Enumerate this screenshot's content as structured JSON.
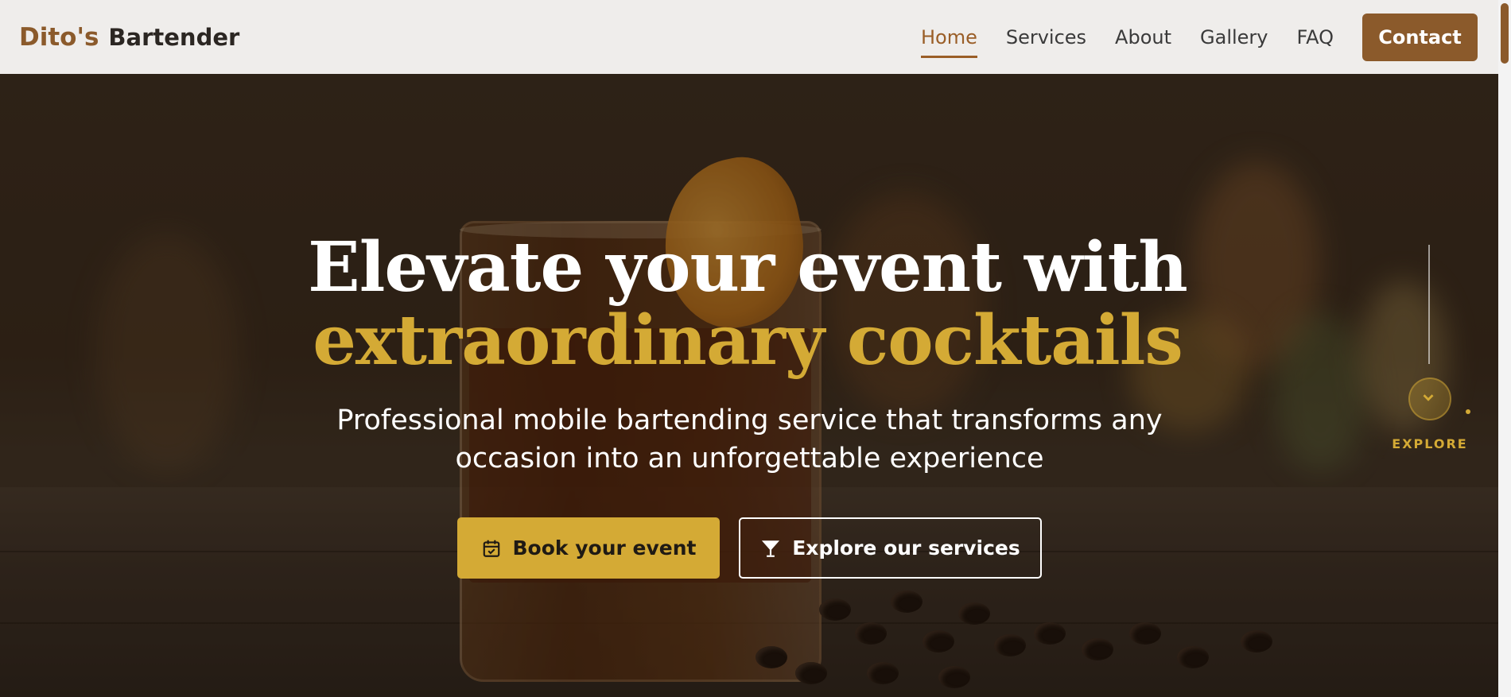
{
  "header": {
    "brand_accent": "Dito's",
    "brand_main": "Bartender",
    "nav": [
      {
        "label": "Home",
        "active": true
      },
      {
        "label": "Services",
        "active": false
      },
      {
        "label": "About",
        "active": false
      },
      {
        "label": "Gallery",
        "active": false
      },
      {
        "label": "FAQ",
        "active": false
      }
    ],
    "contact_label": "Contact"
  },
  "hero": {
    "headline_plain": "Elevate your event with ",
    "headline_accent": "extraordinary cocktails",
    "subtitle": "Professional mobile bartending service that transforms any occasion into an unforgettable experience",
    "book_label": "Book your event",
    "book_icon": "calendar-check-icon",
    "explore_services_label": "Explore our services",
    "explore_services_icon": "cocktail-glass-icon",
    "scroll_label": "EXPLORE",
    "scroll_icon": "chevron-down-icon"
  },
  "colors": {
    "brand_brown": "#8b5a2b",
    "accent_gold": "#d4aa35",
    "header_bg": "#efedeb",
    "active_nav": "#9a5e27"
  }
}
